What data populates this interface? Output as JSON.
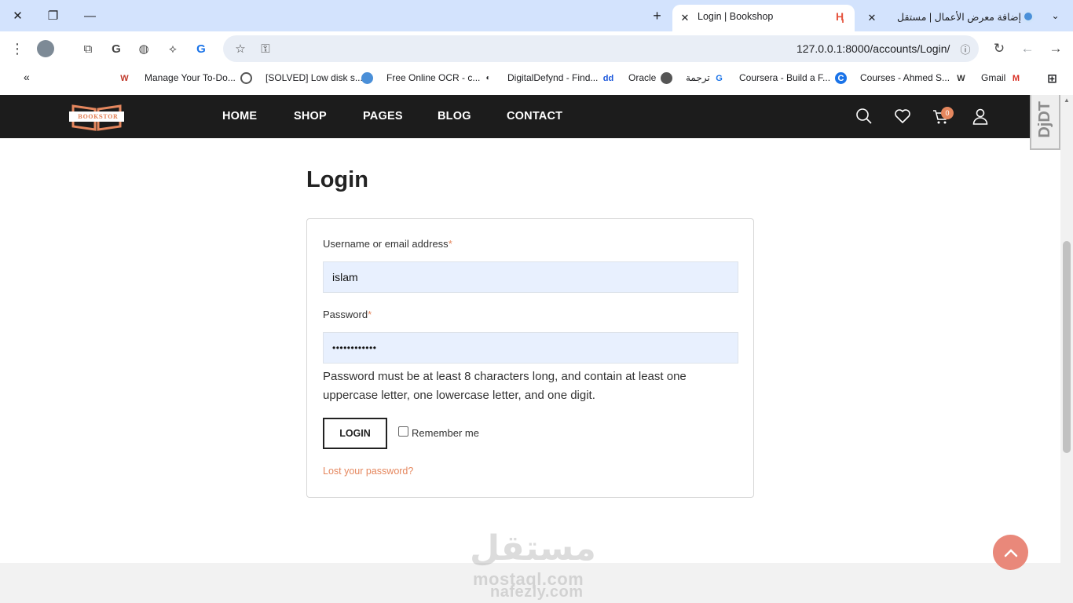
{
  "browser": {
    "tabs": [
      {
        "title": "إضافة معرض الأعمال | مستقل",
        "active": false
      },
      {
        "title": "Login | Bookshop",
        "active": true
      }
    ],
    "url": "127.0.0.1:8000/accounts/Login/",
    "bookmarks": [
      {
        "label": "Manage Your To-Do...",
        "icon": "W"
      },
      {
        "label": "[SOLVED] Low disk s...",
        "icon": "globe"
      },
      {
        "label": "Free Online OCR - c...",
        "icon": "globe"
      },
      {
        "label": "DigitalDefynd - Find...",
        "icon": "globe"
      },
      {
        "label": "Oracle",
        "icon": "dd"
      },
      {
        "label": "ترجمة",
        "icon": "globe"
      },
      {
        "label": "Coursera - Build a F...",
        "icon": "translate"
      },
      {
        "label": "Courses - Ahmed S...",
        "icon": "C"
      },
      {
        "label": "Gmail",
        "icon": "W"
      }
    ]
  },
  "site": {
    "logo_text": "BOOKSTOR",
    "nav": [
      "HOME",
      "SHOP",
      "PAGES",
      "BLOG",
      "CONTACT"
    ],
    "cart_count": "0",
    "debug_toolbar": "DjDT"
  },
  "page": {
    "title": "Login",
    "username_label": "Username or email address",
    "password_label": "Password",
    "required_mark": "*",
    "username_value": "islam",
    "password_value": "••••••••••••",
    "password_help": "Password must be at least 8 characters long, and contain at least one uppercase letter, one lowercase letter, and one digit.",
    "login_button": "LOGIN",
    "remember_label": "Remember me",
    "lost_password": "Lost your password?"
  },
  "watermark": {
    "arabic": "مستقل",
    "line1": "mostaql.com",
    "line2": "nafezly.com"
  },
  "colors": {
    "accent": "#e5875e",
    "nav_bg": "#1c1c1c",
    "input_bg": "#e8f0fe",
    "chrome_bg": "#d3e3fd"
  }
}
